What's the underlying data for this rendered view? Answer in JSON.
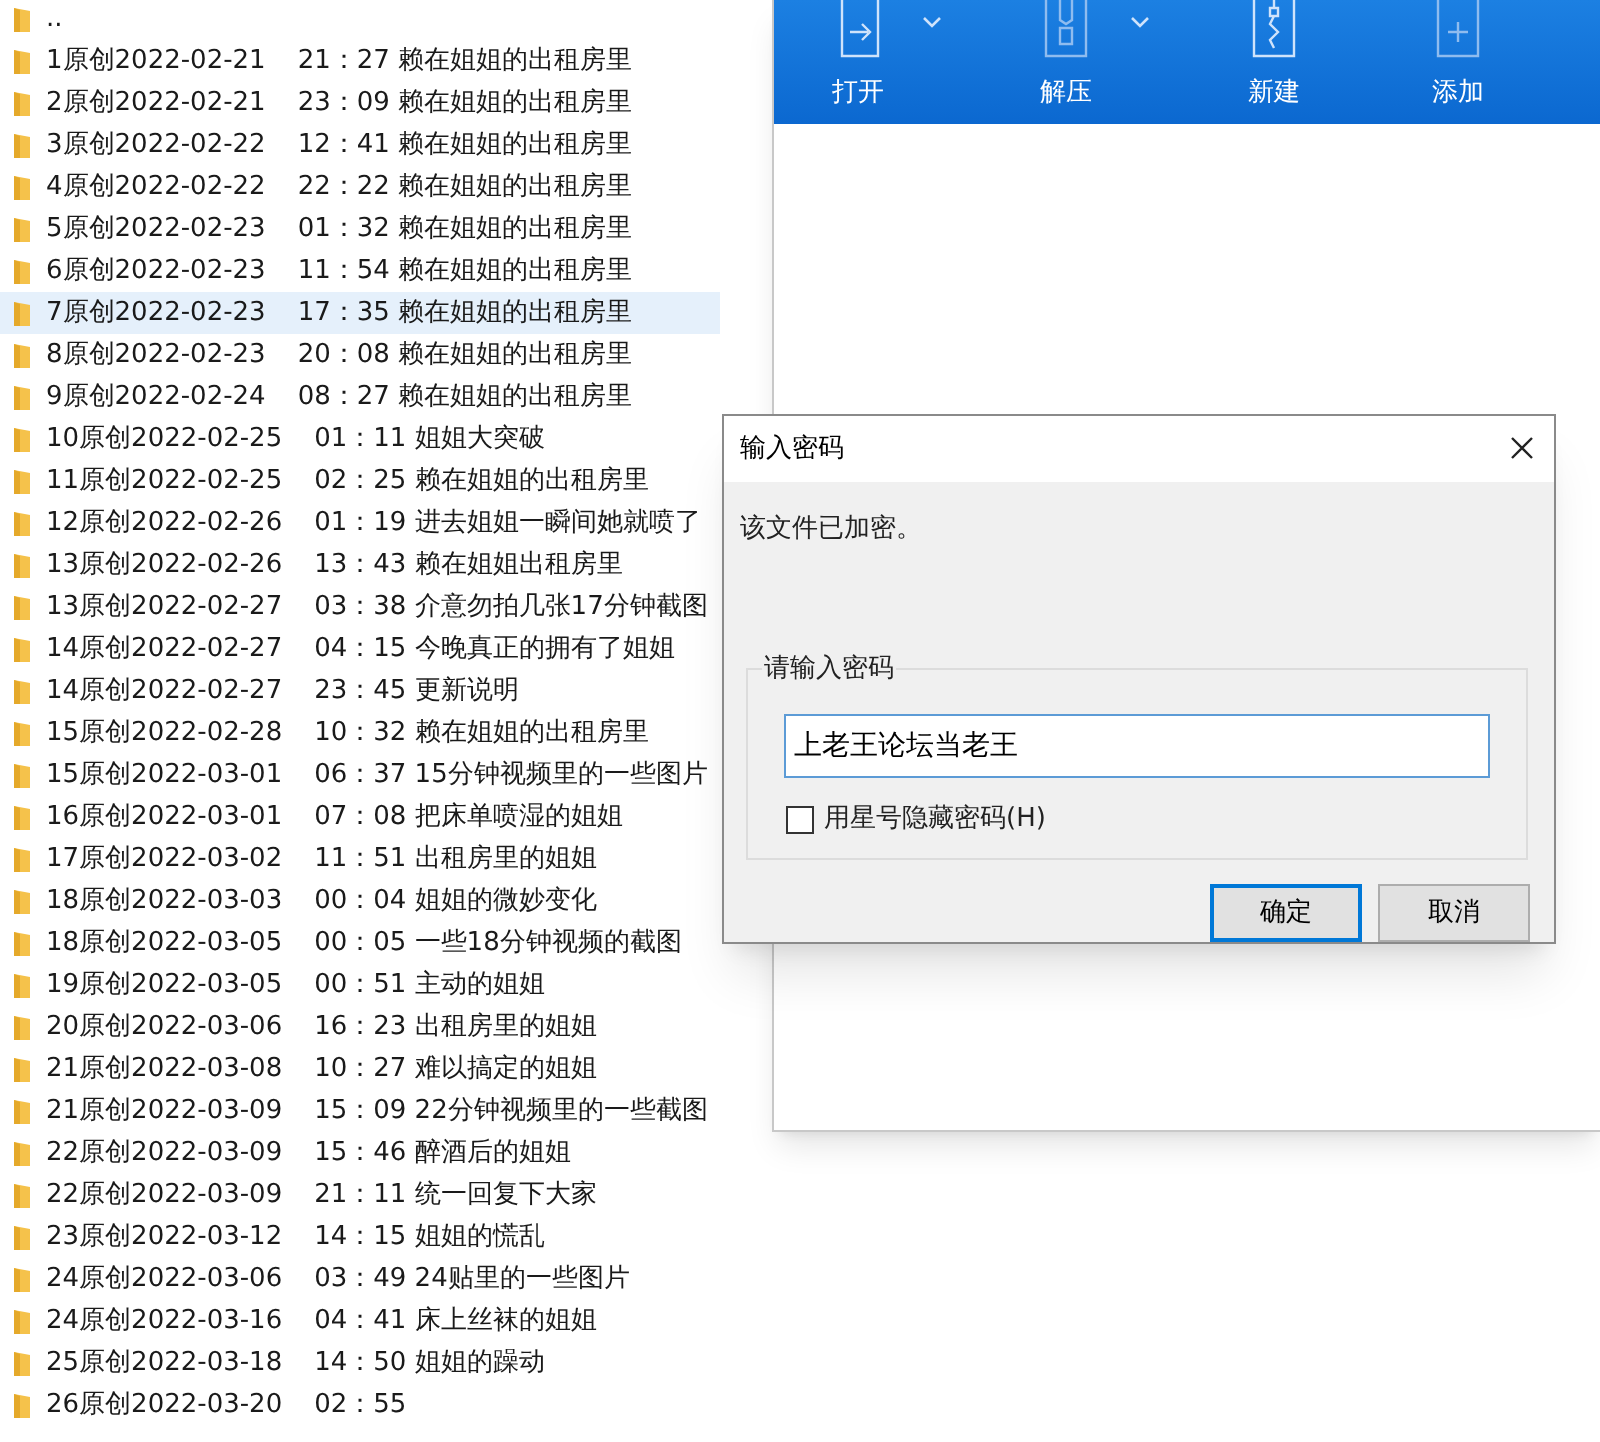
{
  "file_list": [
    {
      "name": "..",
      "selected": false
    },
    {
      "name": "1原创2022-02-21",
      "time_title": "21：27 赖在姐姐的出租房里",
      "selected": false
    },
    {
      "name": "2原创2022-02-21",
      "time_title": "23：09 赖在姐姐的出租房里",
      "selected": false
    },
    {
      "name": "3原创2022-02-22",
      "time_title": "12：41 赖在姐姐的出租房里",
      "selected": false
    },
    {
      "name": "4原创2022-02-22",
      "time_title": "22：22 赖在姐姐的出租房里",
      "selected": false
    },
    {
      "name": "5原创2022-02-23",
      "time_title": "01：32 赖在姐姐的出租房里",
      "selected": false
    },
    {
      "name": "6原创2022-02-23",
      "time_title": "11：54 赖在姐姐的出租房里",
      "selected": false
    },
    {
      "name": "7原创2022-02-23",
      "time_title": "17：35 赖在姐姐的出租房里",
      "selected": true
    },
    {
      "name": "8原创2022-02-23",
      "time_title": "20：08 赖在姐姐的出租房里",
      "selected": false
    },
    {
      "name": "9原创2022-02-24",
      "time_title": "08：27 赖在姐姐的出租房里",
      "selected": false
    },
    {
      "name": "10原创2022-02-25",
      "time_title": "01：11 姐姐大突破",
      "selected": false
    },
    {
      "name": "11原创2022-02-25",
      "time_title": "02：25 赖在姐姐的出租房里",
      "selected": false
    },
    {
      "name": "12原创2022-02-26",
      "time_title": "01：19 进去姐姐一瞬间她就喷了",
      "selected": false
    },
    {
      "name": "13原创2022-02-26",
      "time_title": "13：43 赖在姐姐出租房里",
      "selected": false
    },
    {
      "name": "13原创2022-02-27",
      "time_title": "03：38 介意勿拍几张17分钟截图",
      "selected": false
    },
    {
      "name": "14原创2022-02-27",
      "time_title": "04：15 今晚真正的拥有了姐姐",
      "selected": false
    },
    {
      "name": "14原创2022-02-27",
      "time_title": "23：45 更新说明",
      "selected": false
    },
    {
      "name": "15原创2022-02-28",
      "time_title": "10：32 赖在姐姐的出租房里",
      "selected": false
    },
    {
      "name": "15原创2022-03-01",
      "time_title": "06：37 15分钟视频里的一些图片",
      "selected": false
    },
    {
      "name": "16原创2022-03-01",
      "time_title": "07：08 把床单喷湿的姐姐",
      "selected": false
    },
    {
      "name": "17原创2022-03-02",
      "time_title": "11：51 出租房里的姐姐",
      "selected": false
    },
    {
      "name": "18原创2022-03-03",
      "time_title": "00：04 姐姐的微妙变化",
      "selected": false
    },
    {
      "name": "18原创2022-03-05",
      "time_title": "00：05 一些18分钟视频的截图",
      "selected": false
    },
    {
      "name": "19原创2022-03-05",
      "time_title": "00：51 主动的姐姐",
      "selected": false
    },
    {
      "name": "20原创2022-03-06",
      "time_title": "16：23 出租房里的姐姐",
      "selected": false
    },
    {
      "name": "21原创2022-03-08",
      "time_title": "10：27 难以搞定的姐姐",
      "selected": false
    },
    {
      "name": "21原创2022-03-09",
      "time_title": "15：09 22分钟视频里的一些截图",
      "selected": false
    },
    {
      "name": "22原创2022-03-09",
      "time_title": "15：46 醉酒后的姐姐",
      "selected": false
    },
    {
      "name": "22原创2022-03-09",
      "time_title": "21：11 统一回复下大家",
      "selected": false
    },
    {
      "name": "23原创2022-03-12",
      "time_title": "14：15 姐姐的慌乱",
      "selected": false
    },
    {
      "name": "24原创2022-03-06",
      "time_title": "03：49 24贴里的一些图片",
      "selected": false
    },
    {
      "name": "24原创2022-03-16",
      "time_title": "04：41 床上丝袜的姐姐",
      "selected": false
    },
    {
      "name": "25原创2022-03-18",
      "time_title": "14：50 姐姐的躁动",
      "selected": false
    },
    {
      "name": "26原创2022-03-20",
      "time_title": "02：55",
      "selected": false
    }
  ],
  "toolbar": [
    {
      "label": "打开",
      "kind": "open",
      "dropdown": true
    },
    {
      "label": "解压",
      "kind": "extract",
      "dropdown": true
    },
    {
      "label": "新建",
      "kind": "new",
      "dropdown": false
    },
    {
      "label": "添加",
      "kind": "add",
      "dropdown": false
    }
  ],
  "dialog": {
    "title": "输入密码",
    "message": "该文件已加密。",
    "group_label": "请输入密码",
    "password": "上老王论坛当老王",
    "checkbox": {
      "label": "用星号隐藏密码(H)",
      "checked": false
    },
    "buttons": [
      {
        "label": "确定",
        "default": true
      },
      {
        "label": "取消",
        "default": false
      }
    ]
  }
}
